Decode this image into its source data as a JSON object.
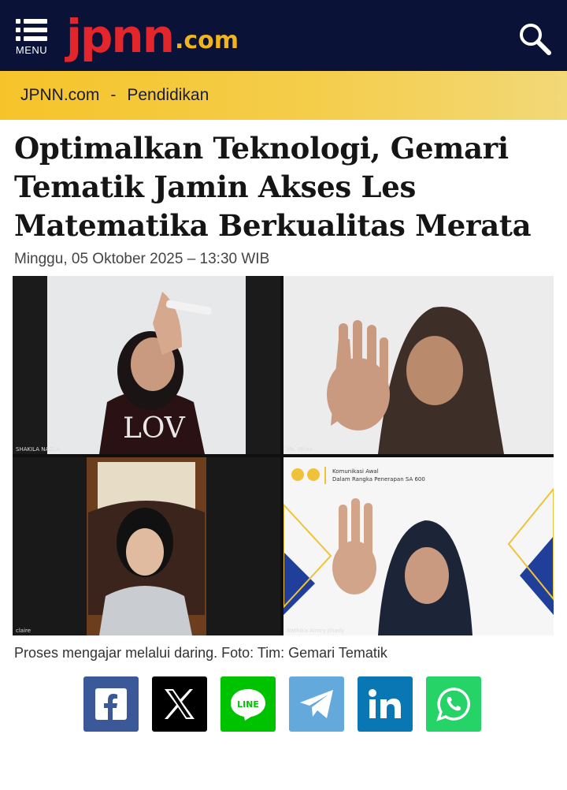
{
  "header": {
    "menu_label": "MENU",
    "logo_brand": "jpnn",
    "logo_tld": ".com",
    "brand_red": "#e3262b",
    "brand_gold": "#f3b31a",
    "bg": "#0b1238"
  },
  "breadcrumb": {
    "home": "JPNN.com",
    "separator": "-",
    "section": "Pendidikan"
  },
  "article": {
    "title": "Optimalkan Teknologi, Gemari Tematik Jamin Akses Les Matematika Berkualitas Merata",
    "date": "Minggu, 05 Oktober 2025 – 13:30 WIB",
    "caption": "Proses mengajar melalui daring. Foto: Tim: Gemari Tematik"
  },
  "photo": {
    "tiles": [
      {
        "name": "SHAKILA NAZLA"
      },
      {
        "name": "Ms. Milaa"
      },
      {
        "name": "claire"
      },
      {
        "name": "Nathika Almry Jihady",
        "slide_line1": "Komunikasi Awal",
        "slide_line2": "Dalam Rangka Penerapan SA 600"
      }
    ],
    "shirt_text": "LOV"
  },
  "share": [
    {
      "icon": "facebook-icon",
      "label": "f",
      "color": "#3b5998"
    },
    {
      "icon": "x-icon",
      "label": "X",
      "color": "#000000"
    },
    {
      "icon": "line-icon",
      "label": "LINE",
      "color": "#00c300"
    },
    {
      "icon": "telegram-icon",
      "label": "",
      "color": "#64a9dc"
    },
    {
      "icon": "linkedin-icon",
      "label": "in",
      "color": "#0a77b5"
    },
    {
      "icon": "whatsapp-icon",
      "label": "",
      "color": "#25d366"
    }
  ]
}
